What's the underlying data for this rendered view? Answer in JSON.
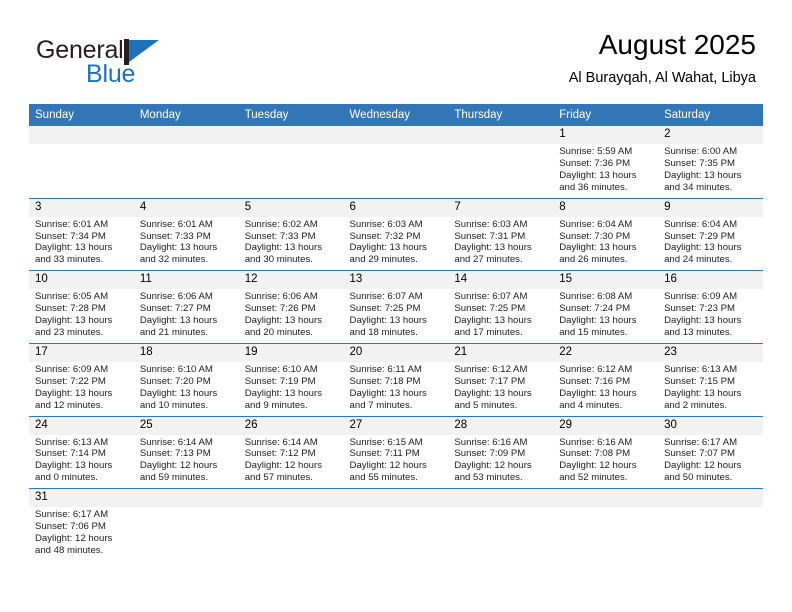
{
  "brand": {
    "name_top": "General",
    "name_bottom": "Blue",
    "accent_color": "#1c72bb",
    "dark_color": "#231f20"
  },
  "header": {
    "title": "August 2025",
    "subtitle": "Al Burayqah, Al Wahat, Libya"
  },
  "theme": {
    "header_blue": "#3276b8",
    "daynum_bg": "#f2f2f2",
    "row_divider": "#3276b8"
  },
  "labels": {
    "sunrise_prefix": "Sunrise:",
    "sunset_prefix": "Sunset:",
    "daylight_prefix": "Daylight:"
  },
  "weekdays": [
    "Sunday",
    "Monday",
    "Tuesday",
    "Wednesday",
    "Thursday",
    "Friday",
    "Saturday"
  ],
  "weeks": [
    [
      {
        "blank": true
      },
      {
        "blank": true
      },
      {
        "blank": true
      },
      {
        "blank": true
      },
      {
        "blank": true
      },
      {
        "day": "1",
        "sunrise": "Sunrise: 5:59 AM",
        "sunset": "Sunset: 7:36 PM",
        "daylight": "Daylight: 13 hours and 36 minutes."
      },
      {
        "day": "2",
        "sunrise": "Sunrise: 6:00 AM",
        "sunset": "Sunset: 7:35 PM",
        "daylight": "Daylight: 13 hours and 34 minutes."
      }
    ],
    [
      {
        "day": "3",
        "sunrise": "Sunrise: 6:01 AM",
        "sunset": "Sunset: 7:34 PM",
        "daylight": "Daylight: 13 hours and 33 minutes."
      },
      {
        "day": "4",
        "sunrise": "Sunrise: 6:01 AM",
        "sunset": "Sunset: 7:33 PM",
        "daylight": "Daylight: 13 hours and 32 minutes."
      },
      {
        "day": "5",
        "sunrise": "Sunrise: 6:02 AM",
        "sunset": "Sunset: 7:33 PM",
        "daylight": "Daylight: 13 hours and 30 minutes."
      },
      {
        "day": "6",
        "sunrise": "Sunrise: 6:03 AM",
        "sunset": "Sunset: 7:32 PM",
        "daylight": "Daylight: 13 hours and 29 minutes."
      },
      {
        "day": "7",
        "sunrise": "Sunrise: 6:03 AM",
        "sunset": "Sunset: 7:31 PM",
        "daylight": "Daylight: 13 hours and 27 minutes."
      },
      {
        "day": "8",
        "sunrise": "Sunrise: 6:04 AM",
        "sunset": "Sunset: 7:30 PM",
        "daylight": "Daylight: 13 hours and 26 minutes."
      },
      {
        "day": "9",
        "sunrise": "Sunrise: 6:04 AM",
        "sunset": "Sunset: 7:29 PM",
        "daylight": "Daylight: 13 hours and 24 minutes."
      }
    ],
    [
      {
        "day": "10",
        "sunrise": "Sunrise: 6:05 AM",
        "sunset": "Sunset: 7:28 PM",
        "daylight": "Daylight: 13 hours and 23 minutes."
      },
      {
        "day": "11",
        "sunrise": "Sunrise: 6:06 AM",
        "sunset": "Sunset: 7:27 PM",
        "daylight": "Daylight: 13 hours and 21 minutes."
      },
      {
        "day": "12",
        "sunrise": "Sunrise: 6:06 AM",
        "sunset": "Sunset: 7:26 PM",
        "daylight": "Daylight: 13 hours and 20 minutes."
      },
      {
        "day": "13",
        "sunrise": "Sunrise: 6:07 AM",
        "sunset": "Sunset: 7:25 PM",
        "daylight": "Daylight: 13 hours and 18 minutes."
      },
      {
        "day": "14",
        "sunrise": "Sunrise: 6:07 AM",
        "sunset": "Sunset: 7:25 PM",
        "daylight": "Daylight: 13 hours and 17 minutes."
      },
      {
        "day": "15",
        "sunrise": "Sunrise: 6:08 AM",
        "sunset": "Sunset: 7:24 PM",
        "daylight": "Daylight: 13 hours and 15 minutes."
      },
      {
        "day": "16",
        "sunrise": "Sunrise: 6:09 AM",
        "sunset": "Sunset: 7:23 PM",
        "daylight": "Daylight: 13 hours and 13 minutes."
      }
    ],
    [
      {
        "day": "17",
        "sunrise": "Sunrise: 6:09 AM",
        "sunset": "Sunset: 7:22 PM",
        "daylight": "Daylight: 13 hours and 12 minutes."
      },
      {
        "day": "18",
        "sunrise": "Sunrise: 6:10 AM",
        "sunset": "Sunset: 7:20 PM",
        "daylight": "Daylight: 13 hours and 10 minutes."
      },
      {
        "day": "19",
        "sunrise": "Sunrise: 6:10 AM",
        "sunset": "Sunset: 7:19 PM",
        "daylight": "Daylight: 13 hours and 9 minutes."
      },
      {
        "day": "20",
        "sunrise": "Sunrise: 6:11 AM",
        "sunset": "Sunset: 7:18 PM",
        "daylight": "Daylight: 13 hours and 7 minutes."
      },
      {
        "day": "21",
        "sunrise": "Sunrise: 6:12 AM",
        "sunset": "Sunset: 7:17 PM",
        "daylight": "Daylight: 13 hours and 5 minutes."
      },
      {
        "day": "22",
        "sunrise": "Sunrise: 6:12 AM",
        "sunset": "Sunset: 7:16 PM",
        "daylight": "Daylight: 13 hours and 4 minutes."
      },
      {
        "day": "23",
        "sunrise": "Sunrise: 6:13 AM",
        "sunset": "Sunset: 7:15 PM",
        "daylight": "Daylight: 13 hours and 2 minutes."
      }
    ],
    [
      {
        "day": "24",
        "sunrise": "Sunrise: 6:13 AM",
        "sunset": "Sunset: 7:14 PM",
        "daylight": "Daylight: 13 hours and 0 minutes."
      },
      {
        "day": "25",
        "sunrise": "Sunrise: 6:14 AM",
        "sunset": "Sunset: 7:13 PM",
        "daylight": "Daylight: 12 hours and 59 minutes."
      },
      {
        "day": "26",
        "sunrise": "Sunrise: 6:14 AM",
        "sunset": "Sunset: 7:12 PM",
        "daylight": "Daylight: 12 hours and 57 minutes."
      },
      {
        "day": "27",
        "sunrise": "Sunrise: 6:15 AM",
        "sunset": "Sunset: 7:11 PM",
        "daylight": "Daylight: 12 hours and 55 minutes."
      },
      {
        "day": "28",
        "sunrise": "Sunrise: 6:16 AM",
        "sunset": "Sunset: 7:09 PM",
        "daylight": "Daylight: 12 hours and 53 minutes."
      },
      {
        "day": "29",
        "sunrise": "Sunrise: 6:16 AM",
        "sunset": "Sunset: 7:08 PM",
        "daylight": "Daylight: 12 hours and 52 minutes."
      },
      {
        "day": "30",
        "sunrise": "Sunrise: 6:17 AM",
        "sunset": "Sunset: 7:07 PM",
        "daylight": "Daylight: 12 hours and 50 minutes."
      }
    ],
    [
      {
        "day": "31",
        "sunrise": "Sunrise: 6:17 AM",
        "sunset": "Sunset: 7:06 PM",
        "daylight": "Daylight: 12 hours and 48 minutes."
      },
      {
        "blank": true
      },
      {
        "blank": true
      },
      {
        "blank": true
      },
      {
        "blank": true
      },
      {
        "blank": true
      },
      {
        "blank": true
      }
    ]
  ]
}
